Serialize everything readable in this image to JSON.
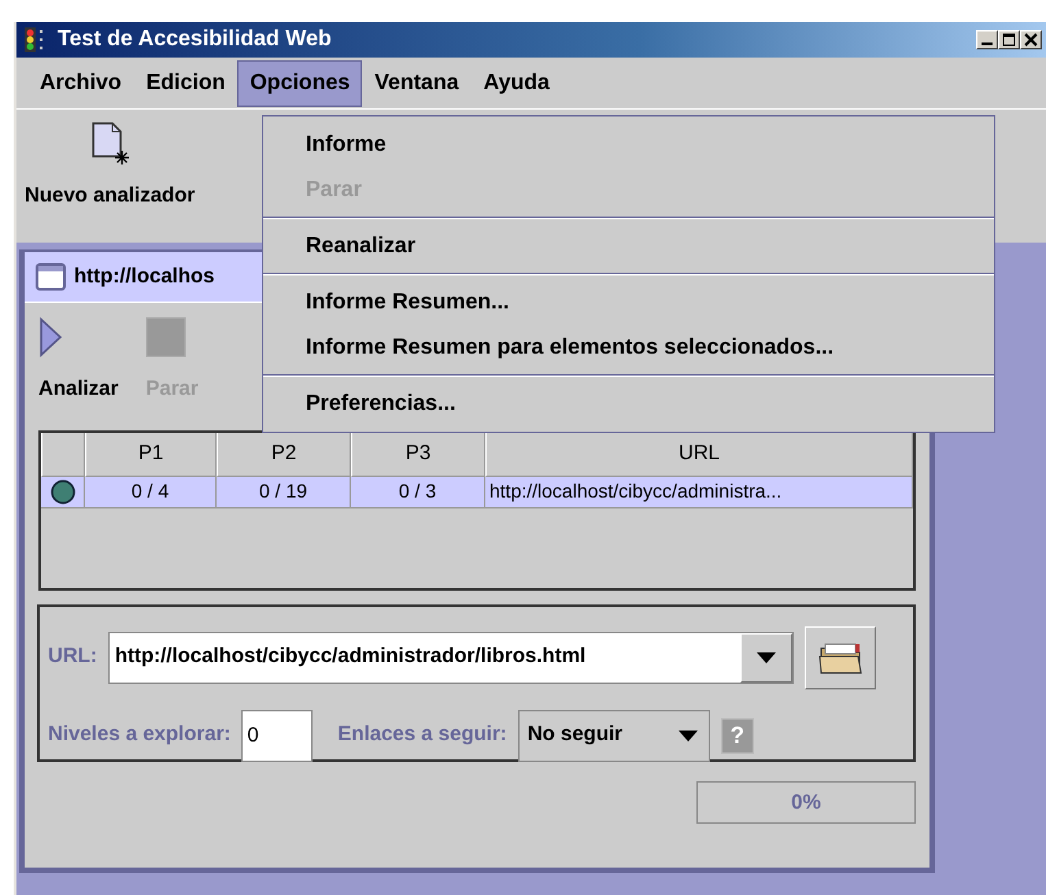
{
  "window": {
    "title": "Test de Accesibilidad Web"
  },
  "menubar": [
    {
      "label": "Archivo",
      "selected": false
    },
    {
      "label": "Edicion",
      "selected": false
    },
    {
      "label": "Opciones",
      "selected": true
    },
    {
      "label": "Ventana",
      "selected": false
    },
    {
      "label": "Ayuda",
      "selected": false
    }
  ],
  "toolbar": [
    {
      "label": "Nuevo analizador"
    }
  ],
  "menu": {
    "items": [
      {
        "kind": "item",
        "label": "Informe",
        "disabled": false
      },
      {
        "kind": "item",
        "label": "Parar",
        "disabled": true
      },
      {
        "kind": "separator"
      },
      {
        "kind": "item",
        "label": "Reanalizar",
        "disabled": false
      },
      {
        "kind": "separator"
      },
      {
        "kind": "item",
        "label": "Informe Resumen...",
        "disabled": false
      },
      {
        "kind": "item",
        "label": "Informe Resumen para elementos seleccionados...",
        "disabled": false
      },
      {
        "kind": "separator"
      },
      {
        "kind": "item",
        "label": "Preferencias...",
        "disabled": false
      }
    ]
  },
  "frame": {
    "title": "http://localhos",
    "toolbar": [
      {
        "label": "Analizar",
        "disabled": false
      },
      {
        "label": "Parar",
        "disabled": true
      }
    ],
    "table": {
      "columns": [
        "P1",
        "P2",
        "P3",
        "URL"
      ],
      "rows": [
        {
          "selected": true,
          "color": "#3f7f73",
          "cells": [
            "0 / 4",
            "0 / 19",
            "0 / 3",
            "http://localhost/cibycc/administra..."
          ]
        }
      ]
    },
    "form": {
      "url_label": "URL:",
      "url_value": "http://localhost/cibycc/administrador/libros.html",
      "levels_label": "Niveles a explorar:",
      "levels_value": "0",
      "links_label": "Enlaces a seguir:",
      "links_value": "No seguir",
      "help": "?"
    },
    "progress": {
      "level": 0,
      "reading": "0%"
    }
  }
}
